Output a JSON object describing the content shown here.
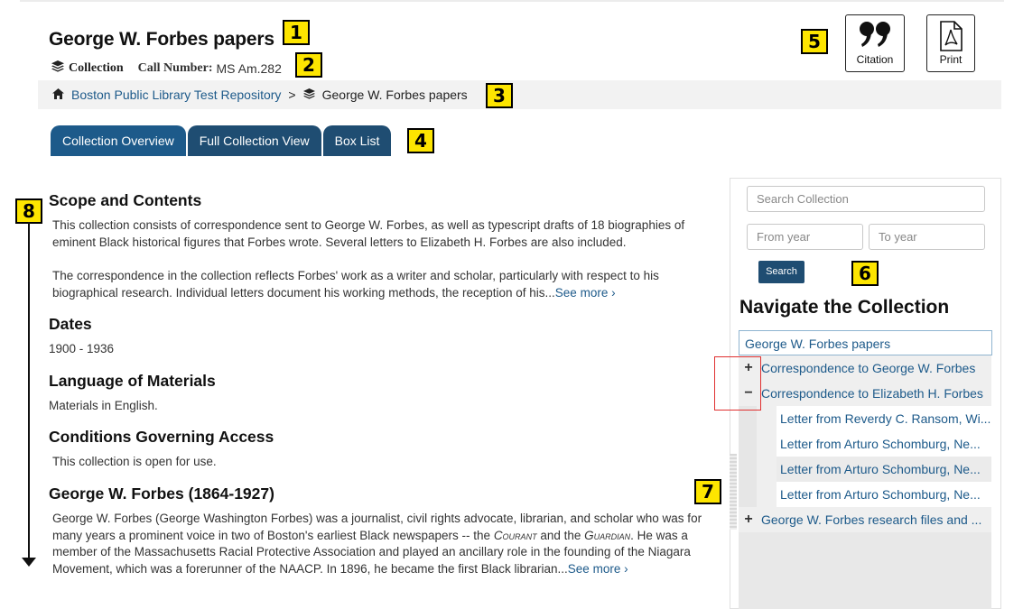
{
  "badges": {
    "b1": "1",
    "b2": "2",
    "b3": "3",
    "b4": "4",
    "b5": "5",
    "b6": "6",
    "b7": "7",
    "b8": "8"
  },
  "header": {
    "title": "George W. Forbes papers",
    "collection_label": "Collection",
    "call_number_label": "Call Number:",
    "call_number": "MS Am.282"
  },
  "actions": {
    "citation": "Citation",
    "print": "Print"
  },
  "breadcrumb": {
    "repository": "Boston Public Library Test Repository",
    "separator": ">",
    "current": "George W. Forbes papers"
  },
  "tabs": [
    "Collection Overview",
    "Full Collection View",
    "Box List"
  ],
  "sections": {
    "scope_heading": "Scope and Contents",
    "scope_p1": "This collection consists of correspondence sent to George W. Forbes, as well as typescript drafts of 18 biographies of eminent Black historical figures that Forbes wrote. Several letters to Elizabeth H. Forbes are also included.",
    "scope_p2": "The correspondence in the collection reflects Forbes' work as a writer and scholar, particularly with respect to his biographical research. Individual letters document his working methods, the reception of his...",
    "see_more": "See more ›",
    "dates_heading": "Dates",
    "dates_value": "1900 - 1936",
    "language_heading": "Language of Materials",
    "language_value": "Materials in English.",
    "access_heading": "Conditions Governing Access",
    "access_value": "This collection is open for use.",
    "bio_heading": "George W. Forbes (1864-1927)",
    "bio_text_a": "George W. Forbes (George Washington Forbes) was a journalist, civil rights advocate, librarian, and scholar who was for many years a prominent voice in two of Boston's earliest Black newspapers -- the ",
    "bio_courant": "Courant",
    "bio_and": " and the ",
    "bio_guardian": "Guardian",
    "bio_text_b": ". He was a member of the Massachusetts Racial Protective Association and played an ancillary role in the founding of the Niagara Movement, which was a forerunner of the NAACP. In 1896, he became the first Black librarian...",
    "bio_see_more": "See more ›"
  },
  "sidebar": {
    "search_placeholder": "Search Collection",
    "from_placeholder": "From year",
    "to_placeholder": "To year",
    "search_button": "Search",
    "nav_heading": "Navigate the Collection",
    "tree": {
      "root": "George W. Forbes papers",
      "items": [
        {
          "toggle": "+",
          "label": "Correspondence to George W. Forbes"
        },
        {
          "toggle": "−",
          "label": "Correspondence to Elizabeth H. Forbes"
        },
        {
          "label": "Letter from Reverdy C. Ransom, Wi..."
        },
        {
          "label": "Letter from Arturo Schomburg, Ne..."
        },
        {
          "label": "Letter from Arturo Schomburg, Ne..."
        },
        {
          "label": "Letter from Arturo Schomburg, Ne..."
        },
        {
          "toggle": "+",
          "label": "George W. Forbes research files and ..."
        }
      ]
    }
  },
  "colors": {
    "link": "#1d5a8a",
    "tab": "#1f4d72",
    "badge": "#fde500",
    "highlight_box": "#e03030"
  }
}
